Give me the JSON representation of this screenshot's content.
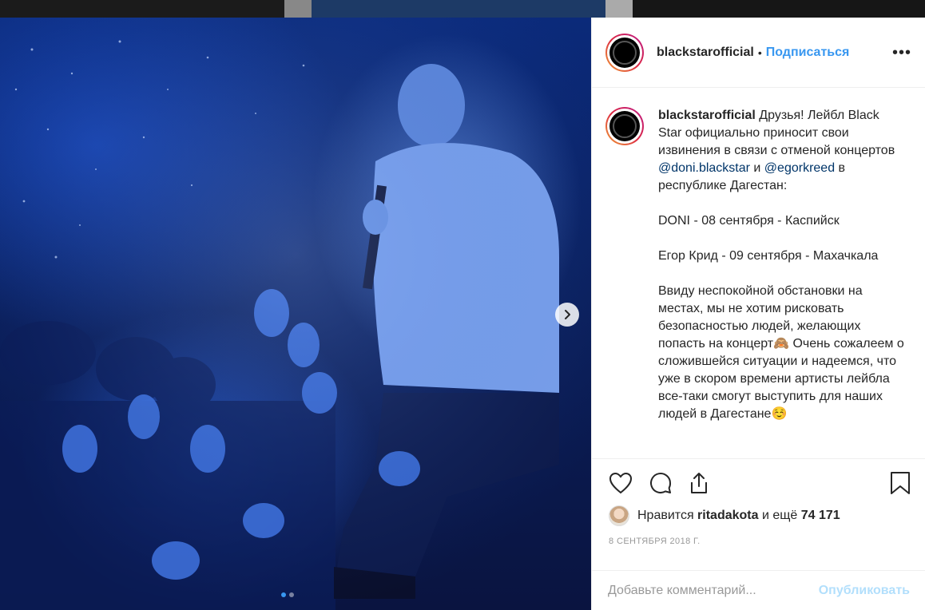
{
  "header": {
    "username": "blackstarofficial",
    "separator": "•",
    "follow_label": "Подписаться",
    "more_label": "•••"
  },
  "caption": {
    "username": "blackstarofficial",
    "text_1": " Друзья! Лейбл Black Star официально приносит свои извинения в связи с отменой концертов ",
    "mention_1": "@doni.blackstar",
    "text_2": " и ",
    "mention_2": "@egorkreed",
    "text_3": " в республике Дагестан:\n\nDONI - 08 сентября - Каспийск\n\nЕгор Крид - 09 сентября - Махачкала\n\nВвиду неспокойной обстановки на местах, мы не хотим рисковать безопасностью людей, желающих попасть на концерт🙈 Очень сожалеем о сложившейся ситуации и надеемся, что уже в скором времени артисты лейбла все-таки смогут выступить для наших людей в Дагестане☺️"
  },
  "likes": {
    "prefix": "Нравится ",
    "user": "ritadakota",
    "middle": " и ещё ",
    "count": "74 171"
  },
  "date": "8 СЕНТЯБРЯ 2018 Г.",
  "comment": {
    "placeholder": "Добавьте комментарий...",
    "publish_label": "Опубликовать"
  },
  "carousel": {
    "current": 1,
    "total": 2
  },
  "colors": {
    "link": "#3897f0",
    "mention": "#003569",
    "publish_disabled": "#b2dffc"
  }
}
